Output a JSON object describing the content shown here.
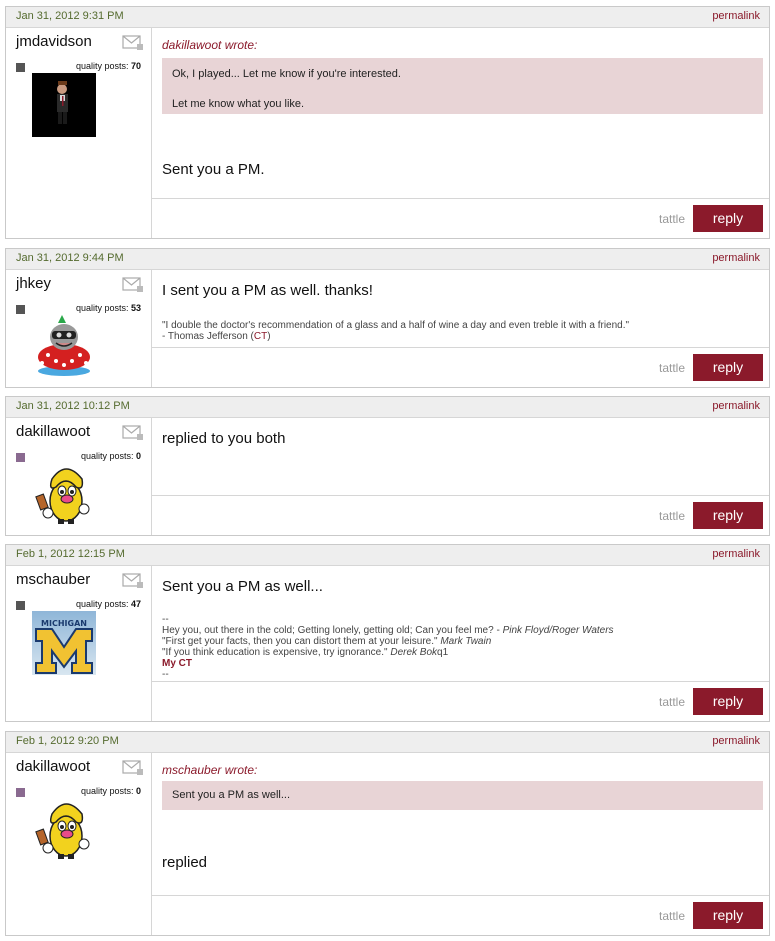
{
  "posts": [
    {
      "date": "Jan 31, 2012 9:31 PM",
      "permalink": "permalink",
      "username": "jmdavidson",
      "quality_label": "quality posts:",
      "quality_count": "70",
      "quote_author": "dakillawoot wrote:",
      "quote_lines": [
        "Ok, I played... Let me know if you're interested.",
        "Let me know what you like."
      ],
      "message": "Sent you a PM.",
      "tattle": "tattle",
      "reply": "reply"
    },
    {
      "date": "Jan 31, 2012 9:44 PM",
      "permalink": "permalink",
      "username": "jhkey",
      "quality_label": "quality posts:",
      "quality_count": "53",
      "message": "I sent you a PM as well. thanks!",
      "sig_quote": "\"I double the doctor's recommendation of a glass and a half of wine a day and even treble it with a friend.\"",
      "sig_author": "- Thomas Jefferson (",
      "sig_ct": "CT",
      "sig_close": ")",
      "tattle": "tattle",
      "reply": "reply"
    },
    {
      "date": "Jan 31, 2012 10:12 PM",
      "permalink": "permalink",
      "username": "dakillawoot",
      "quality_label": "quality posts:",
      "quality_count": "0",
      "message": "replied to you both",
      "tattle": "tattle",
      "reply": "reply"
    },
    {
      "date": "Feb 1, 2012 12:15 PM",
      "permalink": "permalink",
      "username": "mschauber",
      "quality_label": "quality posts:",
      "quality_count": "47",
      "message": "Sent you a PM as well...",
      "sig_dash1": "--",
      "sig_line1": "Hey you, out there in the cold; Getting lonely, getting old; Can you feel me? - ",
      "sig_line1_i": "Pink Floyd/Roger Waters",
      "sig_line2": "\"First get your facts, then you can distort them at your leisure.\" ",
      "sig_line2_i": "Mark Twain",
      "sig_line3": "\"If you think education is expensive, try ignorance.\" ",
      "sig_line3_i": "Derek Bok",
      "sig_line3_tail": "q1",
      "sig_myct": "My CT",
      "sig_dash2": "--",
      "avatar_text": "MICHIGAN",
      "tattle": "tattle",
      "reply": "reply"
    },
    {
      "date": "Feb 1, 2012 9:20 PM",
      "permalink": "permalink",
      "username": "dakillawoot",
      "quality_label": "quality posts:",
      "quality_count": "0",
      "quote_author": "mschauber wrote:",
      "quote_lines": [
        "Sent you a PM as well..."
      ],
      "message": "replied",
      "tattle": "tattle",
      "reply": "reply"
    }
  ],
  "colors": {
    "accent": "#8b1a2b",
    "quote_bg": "#e8d4d6",
    "header_bg": "#eeeeee",
    "date_text": "#556b2f"
  },
  "icons": [
    "mail-icon",
    "avatar-image"
  ]
}
